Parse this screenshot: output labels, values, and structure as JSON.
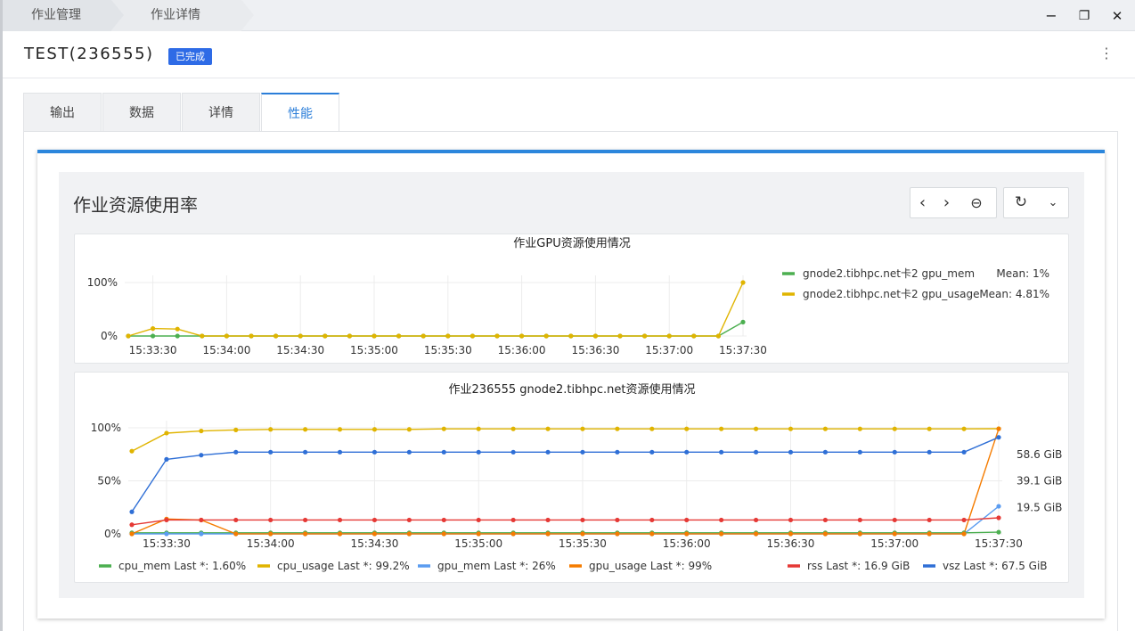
{
  "breadcrumb": {
    "items": [
      "作业管理",
      "作业详情"
    ]
  },
  "window": {
    "minimize": "−",
    "restore": "❐",
    "close": "✕"
  },
  "header": {
    "title": "TEST(236555)",
    "status": "已完成",
    "more": "⋮"
  },
  "tabs": [
    {
      "label": "输出",
      "active": false
    },
    {
      "label": "数据",
      "active": false
    },
    {
      "label": "详情",
      "active": false
    },
    {
      "label": "性能",
      "active": true
    }
  ],
  "card": {
    "title": "作业资源使用率",
    "toolbar": {
      "prev": "‹",
      "next": "›",
      "zoom_out": "⊖",
      "refresh": "↻",
      "dropdown": "⌄"
    }
  },
  "colors": {
    "green": "#4caf50",
    "yellow": "#e0b400",
    "lightblue": "#5b9cf0",
    "orange": "#f57c00",
    "red": "#e53935",
    "blue": "#2f6fd6",
    "accent": "#2b86dc",
    "badge": "#2e6be6"
  },
  "chart_data": [
    {
      "type": "line",
      "title": "作业GPU资源使用情况",
      "x": [
        "15:33:20",
        "15:33:30",
        "15:33:40",
        "15:33:50",
        "15:34:00",
        "15:34:10",
        "15:34:20",
        "15:34:30",
        "15:34:40",
        "15:34:50",
        "15:35:00",
        "15:35:10",
        "15:35:20",
        "15:35:30",
        "15:35:40",
        "15:35:50",
        "15:36:00",
        "15:36:10",
        "15:36:20",
        "15:36:30",
        "15:36:40",
        "15:36:50",
        "15:37:00",
        "15:37:10",
        "15:37:20",
        "15:37:30"
      ],
      "xticks": [
        "15:33:30",
        "15:34:00",
        "15:34:30",
        "15:35:00",
        "15:35:30",
        "15:36:00",
        "15:36:30",
        "15:37:00",
        "15:37:30"
      ],
      "yticks": [
        "0%",
        "100%"
      ],
      "ylim": [
        0,
        100
      ],
      "series": [
        {
          "name": "gnode2.tibhpc.net卡2 gpu_mem",
          "stat": "Mean: 1%",
          "color": "#4caf50",
          "values": [
            0,
            0,
            0,
            0,
            0,
            0,
            0,
            0,
            0,
            0,
            0,
            0,
            0,
            0,
            0,
            0,
            0,
            0,
            0,
            0,
            0,
            0,
            0,
            0,
            0,
            26
          ]
        },
        {
          "name": "gnode2.tibhpc.net卡2 gpu_usage",
          "stat": "Mean: 4.81%",
          "color": "#e0b400",
          "values": [
            0,
            14,
            13,
            0,
            0,
            0,
            0,
            0,
            0,
            0,
            0,
            0,
            0,
            0,
            0,
            0,
            0,
            0,
            0,
            0,
            0,
            0,
            0,
            0,
            0,
            100
          ]
        }
      ]
    },
    {
      "type": "line",
      "title": "作业236555 gnode2.tibhpc.net资源使用情况",
      "x": [
        "15:33:20",
        "15:33:30",
        "15:33:40",
        "15:33:50",
        "15:34:00",
        "15:34:10",
        "15:34:20",
        "15:34:30",
        "15:34:40",
        "15:34:50",
        "15:35:00",
        "15:35:10",
        "15:35:20",
        "15:35:30",
        "15:35:40",
        "15:35:50",
        "15:36:00",
        "15:36:10",
        "15:36:20",
        "15:36:30",
        "15:36:40",
        "15:36:50",
        "15:37:00",
        "15:37:10",
        "15:37:20",
        "15:37:30"
      ],
      "xticks": [
        "15:33:30",
        "15:34:00",
        "15:34:30",
        "15:35:00",
        "15:35:30",
        "15:36:00",
        "15:36:30",
        "15:37:00",
        "15:37:30"
      ],
      "yticks": [
        "0%",
        "50%",
        "100%"
      ],
      "y2ticks": [
        "19.5 GiB",
        "39.1 GiB",
        "58.6 GiB"
      ],
      "ylim": [
        0,
        100
      ],
      "y2lim": [
        0,
        78
      ],
      "series": [
        {
          "name": "cpu_mem",
          "stat": "Last *: 1.60%",
          "color": "#4caf50",
          "axis": "left",
          "values": [
            1,
            1,
            1,
            1,
            1,
            1,
            1,
            1,
            1,
            1,
            1,
            1,
            1,
            1,
            1,
            1,
            1,
            1,
            1,
            1,
            1,
            1,
            1,
            1,
            1,
            1.6
          ]
        },
        {
          "name": "cpu_usage",
          "stat": "Last *: 99.2%",
          "color": "#e0b400",
          "axis": "left",
          "values": [
            78,
            95,
            97,
            98,
            98.5,
            98.5,
            98.5,
            98.5,
            98.5,
            99,
            99,
            99,
            99,
            99,
            99,
            99,
            99,
            99,
            99,
            99,
            99,
            99,
            99,
            99,
            99,
            99.2
          ]
        },
        {
          "name": "gpu_mem",
          "stat": "Last *: 26%",
          "color": "#5b9cf0",
          "axis": "left",
          "values": [
            0,
            0,
            0,
            0,
            0,
            0,
            0,
            0,
            0,
            0,
            0,
            0,
            0,
            0,
            0,
            0,
            0,
            0,
            0,
            0,
            0,
            0,
            0,
            0,
            0,
            26
          ]
        },
        {
          "name": "gpu_usage",
          "stat": "Last *: 99%",
          "color": "#f57c00",
          "axis": "left",
          "values": [
            0,
            14,
            13,
            0,
            0,
            0,
            0,
            0,
            0,
            0,
            0,
            0,
            0,
            0,
            0,
            0,
            0,
            0,
            0,
            0,
            0,
            0,
            0,
            0,
            0,
            99
          ]
        },
        {
          "name": "rss",
          "stat": "Last *: 16.9 GiB",
          "color": "#e53935",
          "axis": "right",
          "values": [
            6.7,
            10.2,
            10.2,
            10.2,
            10.2,
            10.2,
            10.2,
            10.2,
            10.2,
            10.2,
            10.2,
            10.2,
            10.2,
            10.2,
            10.2,
            10.2,
            10.2,
            10.2,
            10.2,
            10.2,
            10.2,
            10.2,
            10.2,
            10.2,
            10.2,
            11.8
          ]
        },
        {
          "name": "vsz",
          "stat": "Last *: 67.5 GiB",
          "color": "#2f6fd6",
          "axis": "right",
          "values": [
            16.2,
            54.8,
            57.9,
            60.1,
            60.1,
            60.1,
            60.1,
            60.1,
            60.1,
            60.1,
            60.1,
            60.1,
            60.1,
            60.1,
            60.1,
            60.1,
            60.1,
            60.1,
            60.1,
            60.1,
            60.1,
            60.1,
            60.1,
            60.1,
            60.1,
            71
          ]
        }
      ]
    }
  ]
}
